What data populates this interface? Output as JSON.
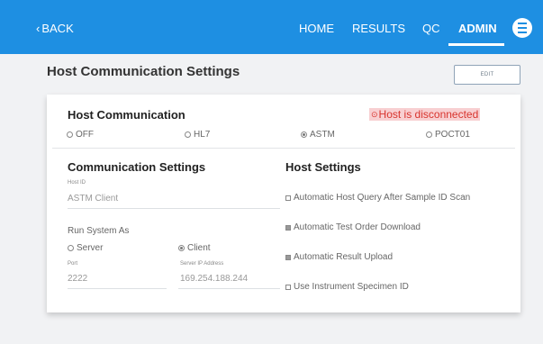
{
  "header": {
    "back_label": "BACK",
    "nav": [
      "HOME",
      "RESULTS",
      "QC",
      "ADMIN"
    ],
    "active_nav": "ADMIN",
    "menu_icon": "hamburger-menu-icon",
    "colors": {
      "bar": "#1e8fe2",
      "text": "#ffffff"
    }
  },
  "page": {
    "title": "Host Communication Settings",
    "edit_label": "EDIT"
  },
  "host_communication": {
    "title": "Host Communication",
    "status": "Host is disconnected",
    "status_icon": "warning-icon",
    "status_color": "#d8342e",
    "options": [
      {
        "label": "OFF",
        "selected": false
      },
      {
        "label": "HL7",
        "selected": false
      },
      {
        "label": "ASTM",
        "selected": true
      },
      {
        "label": "POCT01",
        "selected": false
      }
    ]
  },
  "communication_settings": {
    "title": "Communication Settings",
    "host_id_label": "Host ID",
    "host_id_value": "ASTM Client",
    "run_as_label": "Run System As",
    "run_as_options": [
      {
        "label": "Server",
        "selected": false
      },
      {
        "label": "Client",
        "selected": true
      }
    ],
    "port_label": "Port",
    "port_value": "2222",
    "server_ip_label": "Server IP Address",
    "server_ip_value": "169.254.188.244"
  },
  "host_settings": {
    "title": "Host Settings",
    "options": [
      {
        "label": "Automatic Host Query After Sample ID Scan",
        "checked": false
      },
      {
        "label": "Automatic Test Order Download",
        "checked": true
      },
      {
        "label": "Automatic Result Upload",
        "checked": true
      },
      {
        "label": "Use Instrument Specimen ID",
        "checked": false
      }
    ]
  }
}
